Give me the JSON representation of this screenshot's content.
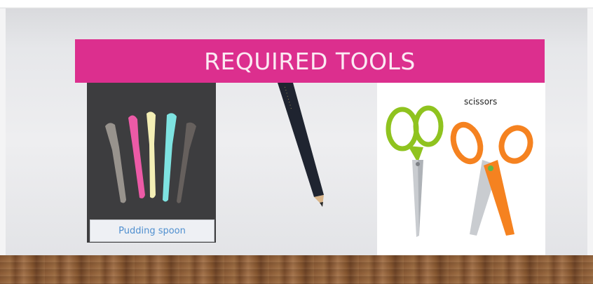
{
  "slide": {
    "title": "REQUIRED TOOLS",
    "spoon_caption": "Pudding spoon",
    "scissors_label": "scissors"
  },
  "icons": [
    "pudding-spoons-icon",
    "pencil-icon",
    "green-scissors-icon",
    "orange-scissors-icon"
  ],
  "colors": {
    "title_band": "#dc2f8e",
    "title_text": "#fbeaf3",
    "caption_text": "#4f8fcf",
    "spoon_dark_panel": "#3d3d3f",
    "spoon_colors": [
      "#a8a29b",
      "#ec5aa6",
      "#f4efb5",
      "#7ee3e1",
      "#6a6460"
    ],
    "pencil_body": "#1f2430",
    "green_scissors": "#8fc31f",
    "orange_scissors": "#f58220",
    "floor": "#8a5a35"
  }
}
